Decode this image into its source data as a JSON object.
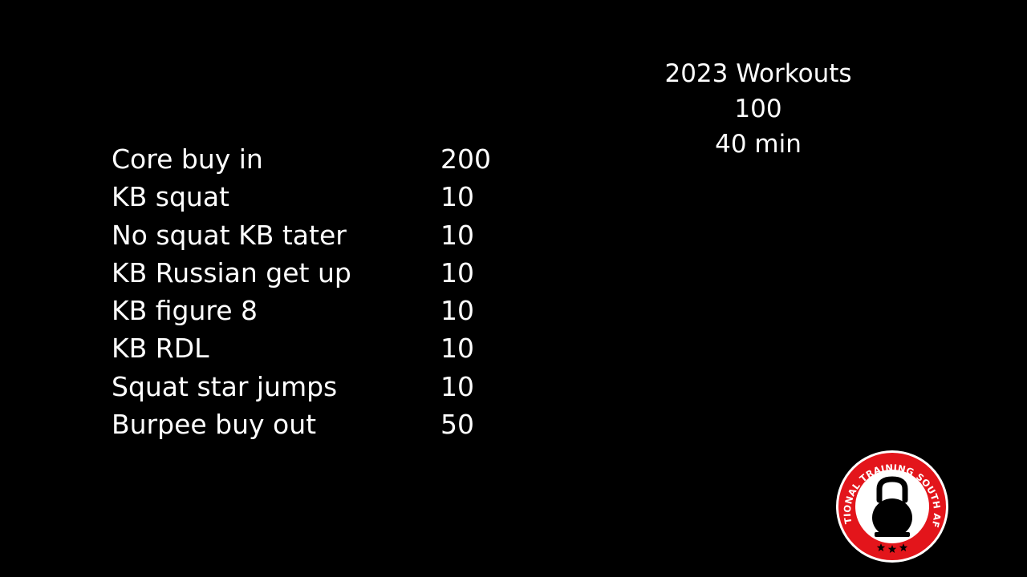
{
  "header": {
    "title": "2023 Workouts",
    "count": "100",
    "duration": "40 min"
  },
  "exercises": [
    {
      "name": "Core buy in",
      "reps": "200"
    },
    {
      "name": "KB squat",
      "reps": "10"
    },
    {
      "name": "No squat KB tater",
      "reps": "10"
    },
    {
      "name": "KB Russian get up",
      "reps": "10"
    },
    {
      "name": "KB figure 8",
      "reps": "10"
    },
    {
      "name": "KB RDL",
      "reps": "10"
    },
    {
      "name": "Squat star jumps",
      "reps": "10"
    },
    {
      "name": "Burpee buy out",
      "reps": "50"
    }
  ],
  "logo": {
    "text": "FUNCTIONAL TRAINING SOUTH AFRICA",
    "icon": "kettlebell-icon",
    "colors": {
      "ring": "#e3151b",
      "inner": "#ffffff",
      "mark": "#000000"
    }
  }
}
